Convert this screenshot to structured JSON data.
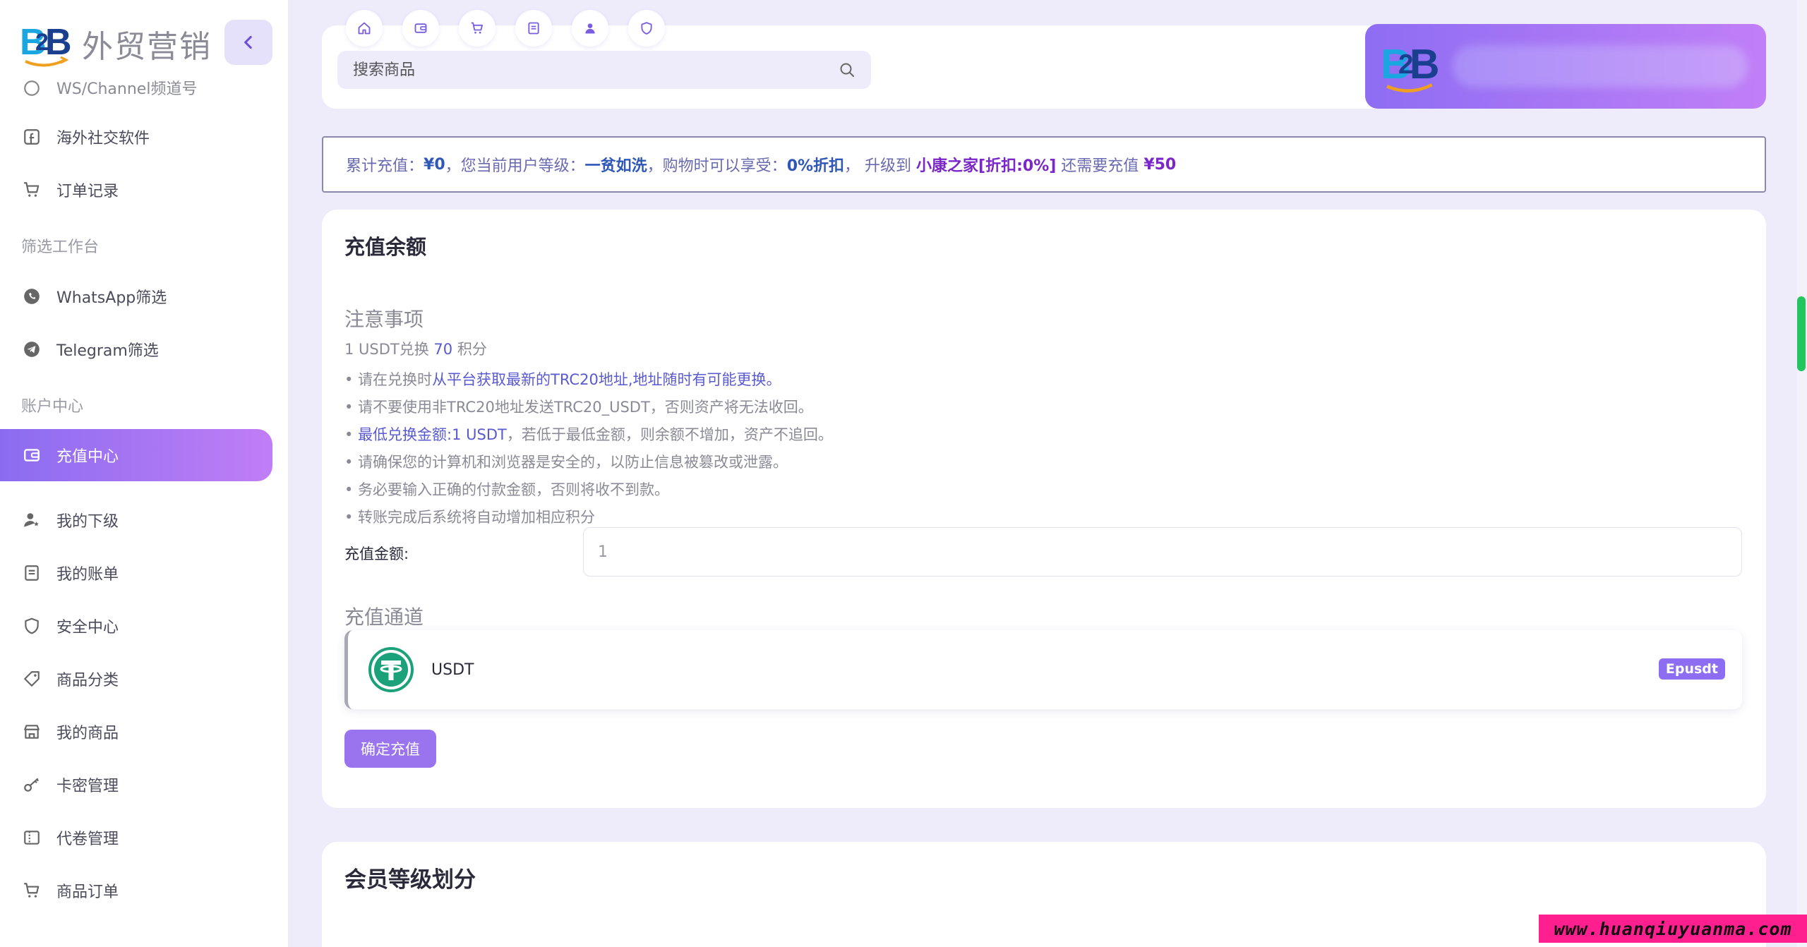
{
  "brand": {
    "name": "外贸营销"
  },
  "sidebar": {
    "clipped_item": "WS/Channel频道号",
    "items_top": [
      {
        "label": "海外社交软件",
        "icon": "facebook-icon"
      },
      {
        "label": "订单记录",
        "icon": "cart-icon"
      }
    ],
    "section_filter": "筛选工作台",
    "items_filter": [
      {
        "label": "WhatsApp筛选",
        "icon": "whatsapp-icon"
      },
      {
        "label": "Telegram筛选",
        "icon": "telegram-icon"
      }
    ],
    "section_account": "账户中心",
    "active_item": {
      "label": "充值中心",
      "icon": "wallet-icon"
    },
    "items_account": [
      {
        "label": "我的下级",
        "icon": "user-star-icon"
      },
      {
        "label": "我的账单",
        "icon": "bill-icon"
      },
      {
        "label": "安全中心",
        "icon": "shield-icon"
      },
      {
        "label": "商品分类",
        "icon": "tag-icon"
      },
      {
        "label": "我的商品",
        "icon": "store-icon"
      },
      {
        "label": "卡密管理",
        "icon": "key-icon"
      },
      {
        "label": "代卷管理",
        "icon": "ticket-icon"
      },
      {
        "label": "商品订单",
        "icon": "cart-icon"
      }
    ]
  },
  "topbar": {
    "quick_tabs": [
      "home-icon",
      "wallet-icon",
      "cart-icon",
      "bill-icon",
      "user-icon",
      "shield-icon"
    ],
    "search_placeholder": "搜索商品"
  },
  "banner": {
    "p1": "累计充值：",
    "total": "¥0",
    "p2": "，您当前用户等级：",
    "level": "一贫如洗",
    "p3": "，购物时可以享受：",
    "discount": "0%折扣",
    "p4": "， 升级到 ",
    "next_level": "小康之家[折扣:0%]",
    "p5": " 还需要充值 ",
    "need": "¥50"
  },
  "recharge": {
    "title": "充值余额",
    "notes_title": "注意事项",
    "rate_prefix": "1 USDT兑换 ",
    "rate_value": "70",
    "rate_suffix": " 积分",
    "notes": {
      "n1_pre": "• 请在兑换时",
      "n1_hl": "从平台获取最新的TRC20地址,地址随时有可能更换。",
      "n2": "• 请不要使用非TRC20地址发送TRC20_USDT，否则资产将无法收回。",
      "n3_pre": "• ",
      "n3_hl": "最低兑换金额:1 USDT",
      "n3_post": "，若低于最低金额，则余额不增加，资产不追回。",
      "n4": "• 请确保您的计算机和浏览器是安全的，以防止信息被篡改或泄露。",
      "n5": "• 务必要输入正确的付款金额，否则将收不到款。",
      "n6": "• 转账完成后系统将自动增加相应积分"
    },
    "amount_label": "充值金额:",
    "amount_value": "1",
    "channel_title": "充值通道",
    "channel_name": "USDT",
    "channel_badge": "Epusdt",
    "submit_label": "确定充值"
  },
  "membership": {
    "title": "会员等级划分"
  },
  "watermark": "www.huanqiuyuanma.com",
  "colors": {
    "accent": "#8b6cf0",
    "accent_light": "#c07ef6",
    "background": "#eeebfb",
    "tether": "#1ba27a",
    "highlight_blue": "#2f57b8",
    "highlight_purple": "#7a26c9"
  }
}
